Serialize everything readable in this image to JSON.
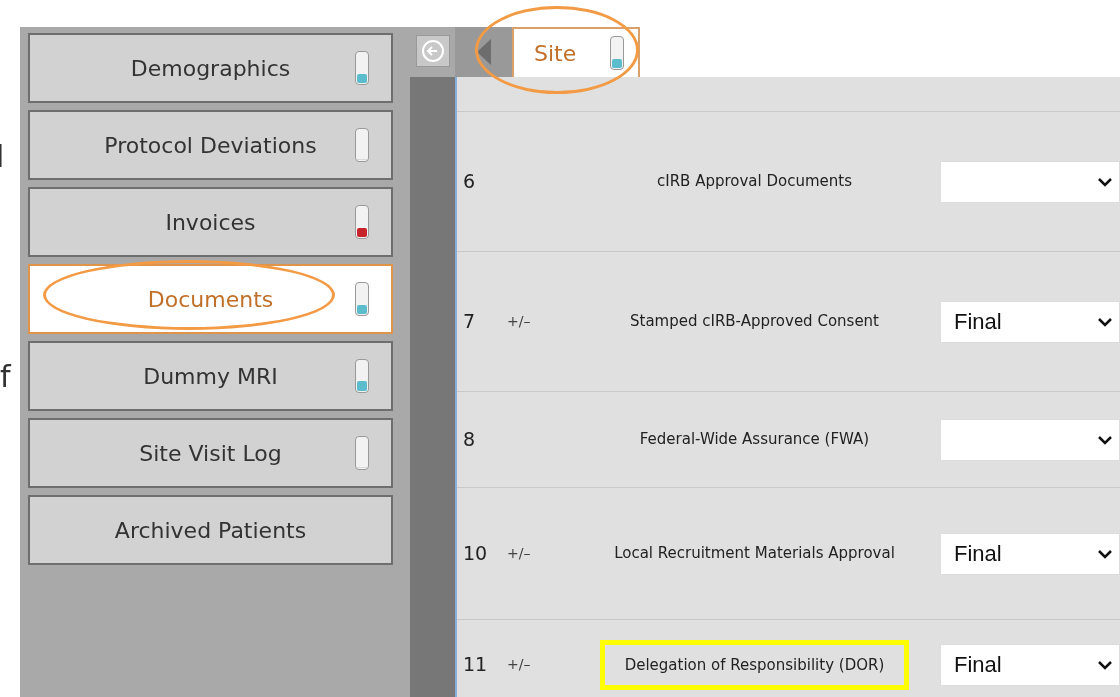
{
  "edge_text": [
    "l",
    "f"
  ],
  "sidebar": {
    "items": [
      {
        "label": "Demographics",
        "selected": false,
        "circled": false,
        "vial": {
          "level": 0.3,
          "color": "#5bbccc"
        }
      },
      {
        "label": "Protocol Deviations",
        "selected": false,
        "circled": false,
        "vial": {
          "level": 0
        }
      },
      {
        "label": "Invoices",
        "selected": false,
        "circled": false,
        "vial": {
          "level": 0.3,
          "color": "#c8232b"
        }
      },
      {
        "label": "Documents",
        "selected": true,
        "circled": true,
        "vial": {
          "level": 0.3,
          "color": "#5bbccc"
        }
      },
      {
        "label": "Dummy MRI",
        "selected": false,
        "circled": false,
        "vial": {
          "level": 0.35,
          "color": "#5bbccc"
        }
      },
      {
        "label": "Site Visit Log",
        "selected": false,
        "circled": false,
        "vial": {
          "level": 0
        }
      },
      {
        "label": "Archived Patients",
        "selected": false,
        "circled": false
      }
    ]
  },
  "tabs": [
    {
      "label": "Site",
      "selected": true,
      "circled": true,
      "vial": {
        "level": 0.3,
        "color": "#5bbccc"
      }
    }
  ],
  "documents": [
    {
      "number": "6",
      "name": "cIRB Approval Documents",
      "boxed": false
    },
    {
      "number": "7",
      "toggle": "+/–",
      "name": "Stamped cIRB-Approved Consent",
      "status": "Final",
      "boxed": false
    },
    {
      "number": "8",
      "name": "Federal-Wide Assurance (FWA)",
      "boxed": false
    },
    {
      "number": "10",
      "toggle": "+/–",
      "name": "Local Recruitment Materials Approval",
      "status": "Final",
      "boxed": false
    },
    {
      "number": "11",
      "toggle": "+/–",
      "name": "Delegation of Responsibility (DOR)",
      "status": "Final",
      "boxed": true
    }
  ]
}
